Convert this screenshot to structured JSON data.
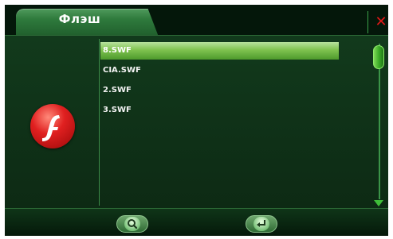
{
  "window": {
    "title": "Флэш",
    "close_label": "✕"
  },
  "file_list": {
    "items": [
      {
        "label": "8.SWF",
        "selected": true
      },
      {
        "label": "CIA.SWF",
        "selected": false
      },
      {
        "label": "2.SWF",
        "selected": false
      },
      {
        "label": "3.SWF",
        "selected": false
      }
    ]
  },
  "icons": {
    "logo": "flash-logo-icon",
    "close": "close-icon",
    "scroll_down": "triangle-down-icon",
    "search": "magnifier-icon",
    "enter": "return-arrow-icon"
  },
  "colors": {
    "background": "#04170a",
    "accent_green": "#3fae2a",
    "selection": "#7fc24f",
    "close_red": "#e01818",
    "logo_red": "#e02020"
  }
}
